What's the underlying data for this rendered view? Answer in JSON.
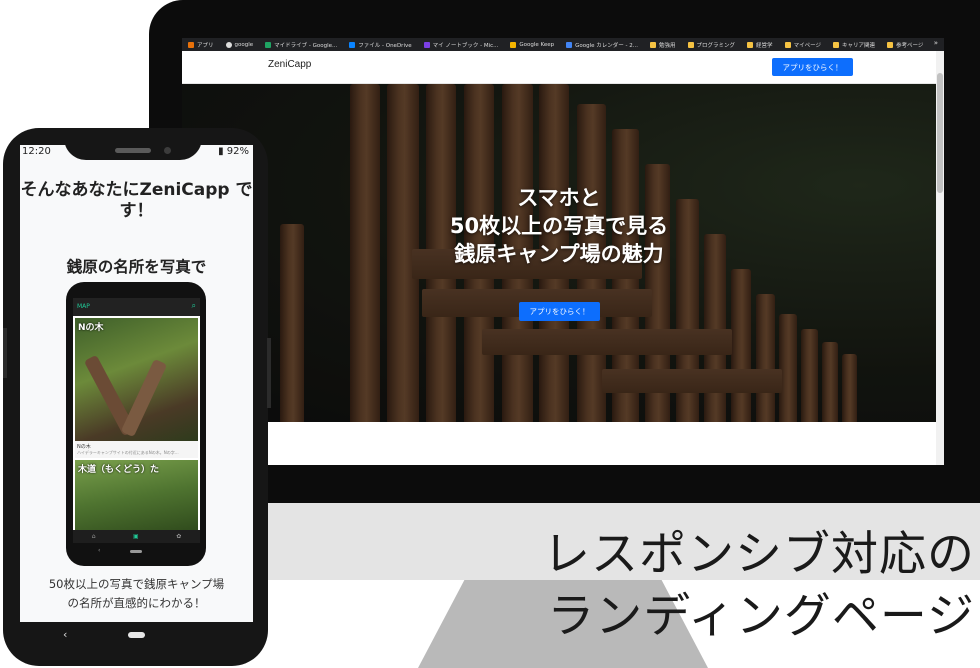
{
  "bookmarks": [
    {
      "label": "アプリ",
      "color": "#e8710a"
    },
    {
      "label": "google",
      "color": "#dddddd"
    },
    {
      "label": "マイドライブ - Google...",
      "color": "#1fa463"
    },
    {
      "label": "ファイル - OneDrive",
      "color": "#0a84ff"
    },
    {
      "label": "マイ ノートブック - Mic...",
      "color": "#7b3fe4"
    },
    {
      "label": "Google Keep",
      "color": "#f4b400"
    },
    {
      "label": "Google カレンダー - 2...",
      "color": "#4285f4"
    },
    {
      "label": "勉強用",
      "color": "#f6c343"
    },
    {
      "label": "プログラミング",
      "color": "#f6c343"
    },
    {
      "label": "経営学",
      "color": "#f6c343"
    },
    {
      "label": "マイページ",
      "color": "#f6c343"
    },
    {
      "label": "キャリア関連",
      "color": "#f6c343"
    },
    {
      "label": "参考ページ",
      "color": "#f6c343"
    }
  ],
  "bookmarks_more": "»",
  "site": {
    "brand": "ZeniCapp",
    "nav_cta": "アプリをひらく！",
    "hero_title_lines": [
      "スマホと",
      "50枚以上の写真で見る",
      "銭原キャンプ場の魅力"
    ],
    "hero_cta": "アプリをひらく！"
  },
  "caption": {
    "line1": "レスポンシブ対応の",
    "line2": "ランディングページ"
  },
  "phone": {
    "time": "12:20",
    "battery": "92%",
    "title": "そんなあなたにZeniCapp です！",
    "subtitle": "銭原の名所を写真で",
    "desc_line1": "50枚以上の写真で銭原キャンプ場",
    "desc_line2": "の名所が直感的にわかる！",
    "back_glyph": "‹"
  },
  "mini": {
    "appbar_title": "MAP",
    "search_icon": "⌕",
    "card1_overlay": "Nの木",
    "card1_caption": "Nの木",
    "card1_desc": "ハイデラーキャンプサイトの付近にあるNの木。Nの字...",
    "card2_overlay": "木道（もくどう）た",
    "nav_items": [
      "⌂",
      "▣",
      "✿"
    ],
    "back_glyph": "‹"
  },
  "colors": {
    "accent": "#0d6efd",
    "teal": "#20c997"
  }
}
